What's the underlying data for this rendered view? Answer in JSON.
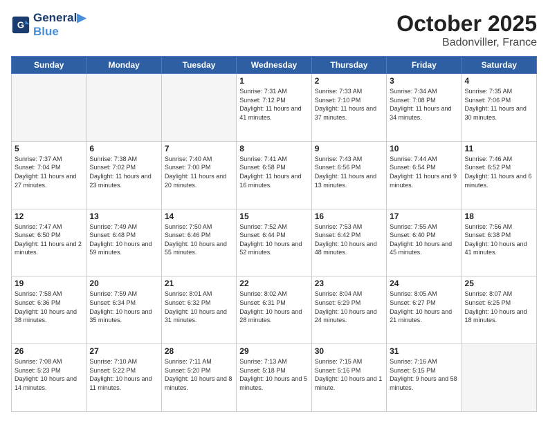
{
  "header": {
    "logo_line1": "General",
    "logo_line2": "Blue",
    "month": "October 2025",
    "location": "Badonviller, France"
  },
  "days_of_week": [
    "Sunday",
    "Monday",
    "Tuesday",
    "Wednesday",
    "Thursday",
    "Friday",
    "Saturday"
  ],
  "weeks": [
    [
      {
        "day": "",
        "empty": true
      },
      {
        "day": "",
        "empty": true
      },
      {
        "day": "",
        "empty": true
      },
      {
        "day": "1",
        "sunrise": "7:31 AM",
        "sunset": "7:12 PM",
        "daylight": "11 hours and 41 minutes."
      },
      {
        "day": "2",
        "sunrise": "7:33 AM",
        "sunset": "7:10 PM",
        "daylight": "11 hours and 37 minutes."
      },
      {
        "day": "3",
        "sunrise": "7:34 AM",
        "sunset": "7:08 PM",
        "daylight": "11 hours and 34 minutes."
      },
      {
        "day": "4",
        "sunrise": "7:35 AM",
        "sunset": "7:06 PM",
        "daylight": "11 hours and 30 minutes."
      }
    ],
    [
      {
        "day": "5",
        "sunrise": "7:37 AM",
        "sunset": "7:04 PM",
        "daylight": "11 hours and 27 minutes."
      },
      {
        "day": "6",
        "sunrise": "7:38 AM",
        "sunset": "7:02 PM",
        "daylight": "11 hours and 23 minutes."
      },
      {
        "day": "7",
        "sunrise": "7:40 AM",
        "sunset": "7:00 PM",
        "daylight": "11 hours and 20 minutes."
      },
      {
        "day": "8",
        "sunrise": "7:41 AM",
        "sunset": "6:58 PM",
        "daylight": "11 hours and 16 minutes."
      },
      {
        "day": "9",
        "sunrise": "7:43 AM",
        "sunset": "6:56 PM",
        "daylight": "11 hours and 13 minutes."
      },
      {
        "day": "10",
        "sunrise": "7:44 AM",
        "sunset": "6:54 PM",
        "daylight": "11 hours and 9 minutes."
      },
      {
        "day": "11",
        "sunrise": "7:46 AM",
        "sunset": "6:52 PM",
        "daylight": "11 hours and 6 minutes."
      }
    ],
    [
      {
        "day": "12",
        "sunrise": "7:47 AM",
        "sunset": "6:50 PM",
        "daylight": "11 hours and 2 minutes."
      },
      {
        "day": "13",
        "sunrise": "7:49 AM",
        "sunset": "6:48 PM",
        "daylight": "10 hours and 59 minutes."
      },
      {
        "day": "14",
        "sunrise": "7:50 AM",
        "sunset": "6:46 PM",
        "daylight": "10 hours and 55 minutes."
      },
      {
        "day": "15",
        "sunrise": "7:52 AM",
        "sunset": "6:44 PM",
        "daylight": "10 hours and 52 minutes."
      },
      {
        "day": "16",
        "sunrise": "7:53 AM",
        "sunset": "6:42 PM",
        "daylight": "10 hours and 48 minutes."
      },
      {
        "day": "17",
        "sunrise": "7:55 AM",
        "sunset": "6:40 PM",
        "daylight": "10 hours and 45 minutes."
      },
      {
        "day": "18",
        "sunrise": "7:56 AM",
        "sunset": "6:38 PM",
        "daylight": "10 hours and 41 minutes."
      }
    ],
    [
      {
        "day": "19",
        "sunrise": "7:58 AM",
        "sunset": "6:36 PM",
        "daylight": "10 hours and 38 minutes."
      },
      {
        "day": "20",
        "sunrise": "7:59 AM",
        "sunset": "6:34 PM",
        "daylight": "10 hours and 35 minutes."
      },
      {
        "day": "21",
        "sunrise": "8:01 AM",
        "sunset": "6:32 PM",
        "daylight": "10 hours and 31 minutes."
      },
      {
        "day": "22",
        "sunrise": "8:02 AM",
        "sunset": "6:31 PM",
        "daylight": "10 hours and 28 minutes."
      },
      {
        "day": "23",
        "sunrise": "8:04 AM",
        "sunset": "6:29 PM",
        "daylight": "10 hours and 24 minutes."
      },
      {
        "day": "24",
        "sunrise": "8:05 AM",
        "sunset": "6:27 PM",
        "daylight": "10 hours and 21 minutes."
      },
      {
        "day": "25",
        "sunrise": "8:07 AM",
        "sunset": "6:25 PM",
        "daylight": "10 hours and 18 minutes."
      }
    ],
    [
      {
        "day": "26",
        "sunrise": "7:08 AM",
        "sunset": "5:23 PM",
        "daylight": "10 hours and 14 minutes."
      },
      {
        "day": "27",
        "sunrise": "7:10 AM",
        "sunset": "5:22 PM",
        "daylight": "10 hours and 11 minutes."
      },
      {
        "day": "28",
        "sunrise": "7:11 AM",
        "sunset": "5:20 PM",
        "daylight": "10 hours and 8 minutes."
      },
      {
        "day": "29",
        "sunrise": "7:13 AM",
        "sunset": "5:18 PM",
        "daylight": "10 hours and 5 minutes."
      },
      {
        "day": "30",
        "sunrise": "7:15 AM",
        "sunset": "5:16 PM",
        "daylight": "10 hours and 1 minute."
      },
      {
        "day": "31",
        "sunrise": "7:16 AM",
        "sunset": "5:15 PM",
        "daylight": "9 hours and 58 minutes."
      },
      {
        "day": "",
        "empty": true
      }
    ]
  ]
}
